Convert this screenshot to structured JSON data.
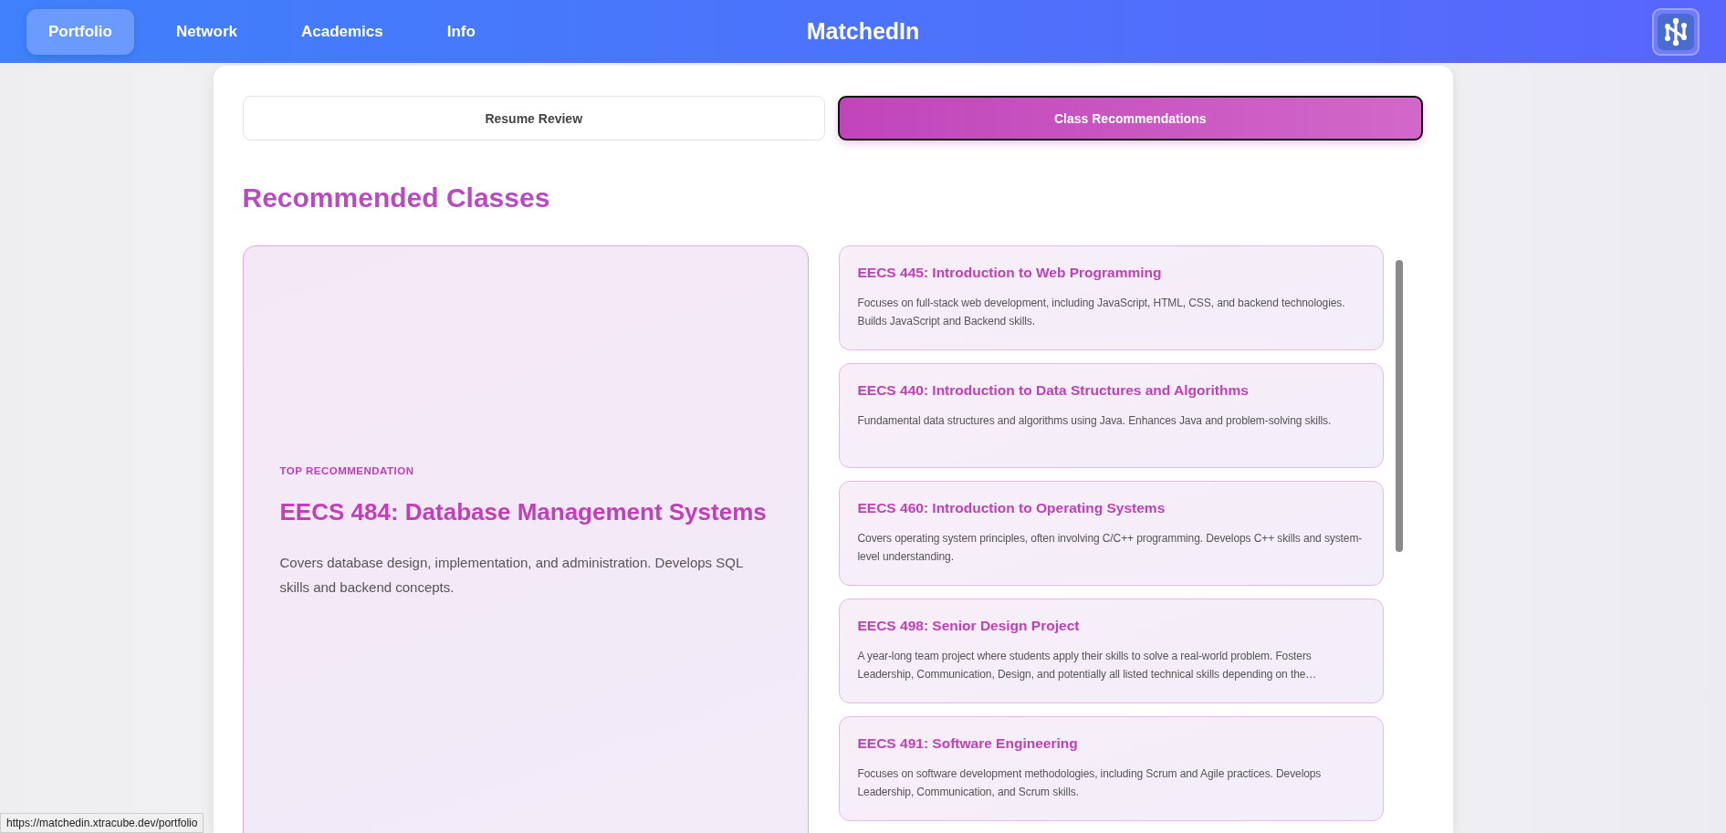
{
  "nav": {
    "items": [
      {
        "label": "Portfolio",
        "selected": true
      },
      {
        "label": "Network",
        "selected": false
      },
      {
        "label": "Academics",
        "selected": false
      },
      {
        "label": "Info",
        "selected": false
      }
    ],
    "brand": "MatchedIn"
  },
  "tabs": [
    {
      "label": "Resume Review",
      "selected": false
    },
    {
      "label": "Class Recommendations",
      "selected": true
    }
  ],
  "heading": "Recommended Classes",
  "top_recommendation": {
    "eyebrow": "TOP RECOMMENDATION",
    "title": "EECS 484: Database Management Systems",
    "description": "Covers database design, implementation, and administration. Develops SQL skills and backend concepts."
  },
  "classes": [
    {
      "title": "EECS 445: Introduction to Web Programming",
      "description": "Focuses on full-stack web development, including JavaScript, HTML, CSS, and backend technologies. Builds JavaScript and Backend skills."
    },
    {
      "title": "EECS 440: Introduction to Data Structures and Algorithms",
      "description": "Fundamental data structures and algorithms using Java. Enhances Java and problem-solving skills."
    },
    {
      "title": "EECS 460: Introduction to Operating Systems",
      "description": "Covers operating system principles, often involving C/C++ programming. Develops C++ skills and system-level understanding."
    },
    {
      "title": "EECS 498: Senior Design Project",
      "description": "A year-long team project where students apply their skills to solve a real-world problem. Fosters Leadership, Communication, Design, and potentially all listed technical skills depending on the…"
    },
    {
      "title": "EECS 491: Software Engineering",
      "description": "Focuses on software development methodologies, including Scrum and Agile practices. Develops Leadership, Communication, and Scrum skills."
    }
  ],
  "status_url": "https://matchedin.xtracube.dev/portfolio"
}
